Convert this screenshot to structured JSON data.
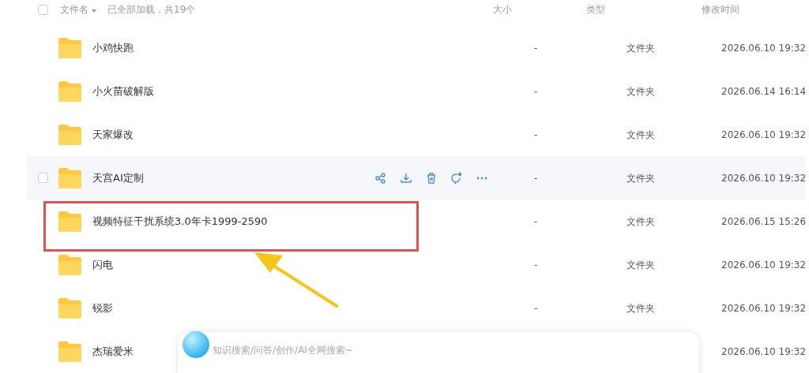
{
  "header": {
    "checked": false,
    "name_label": "文件名",
    "load_status": "已全部加载，共19个",
    "size_label": "大小",
    "type_label": "类型",
    "time_label": "修改时间"
  },
  "rows": [
    {
      "name": "小鸡快跑",
      "size": "-",
      "type": "文件夹",
      "modified": "2026.06.10 19:32",
      "hovered": false,
      "highlighted": false
    },
    {
      "name": "小火苗破解版",
      "size": "-",
      "type": "文件夹",
      "modified": "2026.06.14 16:14",
      "hovered": false,
      "highlighted": false
    },
    {
      "name": "天家爆改",
      "size": "-",
      "type": "文件夹",
      "modified": "2026.06.10 19:32",
      "hovered": false,
      "highlighted": false
    },
    {
      "name": "天宫AI定制",
      "size": "-",
      "type": "文件夹",
      "modified": "2026.06.10 19:32",
      "hovered": true,
      "highlighted": false
    },
    {
      "name": "视频特征干扰系统3.0年卡1999-2590",
      "size": "-",
      "type": "文件夹",
      "modified": "2026.06.15 15:26",
      "hovered": false,
      "highlighted": true
    },
    {
      "name": "闪电",
      "size": "-",
      "type": "文件夹",
      "modified": "2026.06.10 19:32",
      "hovered": false,
      "highlighted": false
    },
    {
      "name": "锐影",
      "size": "-",
      "type": "文件夹",
      "modified": "2026.06.10 19:32",
      "hovered": false,
      "highlighted": false
    },
    {
      "name": "杰瑞爱米",
      "modified": "2026.06.10 19:32",
      "hovered": false,
      "highlighted": false
    }
  ],
  "search": {
    "placeholder": "知识搜索/问答/创作/AI全网搜索~"
  }
}
